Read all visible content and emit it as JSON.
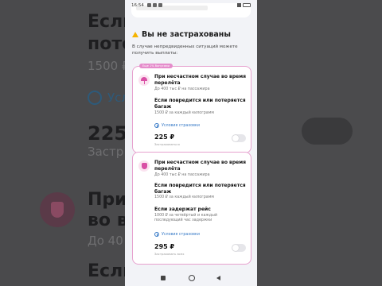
{
  "status_bar": {
    "time": "16:54"
  },
  "section": {
    "title": "Вы не застрахованы",
    "subtitle": "В случае непредвиденных ситуаций можете получить выплаты:"
  },
  "card1": {
    "badge": "Еще 1% бонусами",
    "items": [
      {
        "title": "При несчастном случае во время перелёта",
        "sub": "До 400 тыс ₽ на пассажира"
      },
      {
        "title": "Если повредится или потеряется багаж",
        "sub": "1500 ₽ за каждый килограмм"
      }
    ],
    "conditions": "Условия страховки",
    "price": "225 ₽",
    "price_note": "Застраховаться"
  },
  "card2": {
    "items": [
      {
        "title": "При несчастном случае во время перелёта",
        "sub": "До 400 тыс ₽ на пассажира"
      },
      {
        "title": "Если повредится или потеряется багаж",
        "sub": "1500 ₽ за каждый килограмм"
      },
      {
        "title": "Если задержат рейс",
        "sub": "1000 ₽ за четвёртый и каждый последующий час задержки"
      }
    ],
    "conditions": "Условия страховки",
    "price": "295 ₽",
    "price_note": "Застраховать всех"
  },
  "background": {
    "left_lines": [
      "Если",
      "потер",
      "1500 ₽",
      "Усло",
      "225",
      "Застр",
      "При н",
      "во вре",
      "До 40",
      "Если"
    ]
  },
  "colors": {
    "accent_pink": "#e58ccb",
    "link_blue": "#3478c6",
    "warning": "#f5b400"
  }
}
